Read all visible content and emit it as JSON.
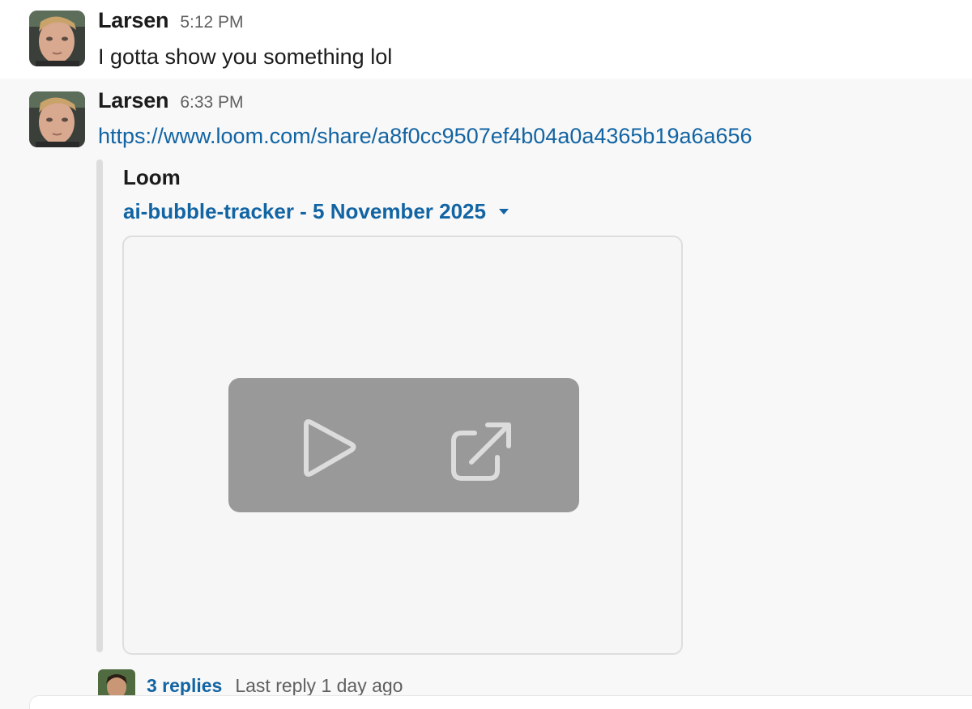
{
  "messages": [
    {
      "sender": "Larsen",
      "time": "5:12 PM",
      "text": "I gotta show you something lol"
    },
    {
      "sender": "Larsen",
      "time": "6:33 PM",
      "link": "https://www.loom.com/share/a8f0cc9507ef4b04a0a4365b19a6a656",
      "unfurl": {
        "source": "Loom",
        "title": "ai-bubble-tracker - 5 November 2025",
        "controls": {
          "play_icon": "play-icon",
          "open_icon": "open-external-icon"
        }
      },
      "thread": {
        "replies": "3 replies",
        "last_reply": "Last reply 1 day ago"
      }
    }
  ],
  "colors": {
    "link": "#1264a3",
    "muted": "#616061",
    "highlight_row": "#f8f8f8",
    "attachment_bar": "#dddddd",
    "video_controls": "#999999"
  }
}
